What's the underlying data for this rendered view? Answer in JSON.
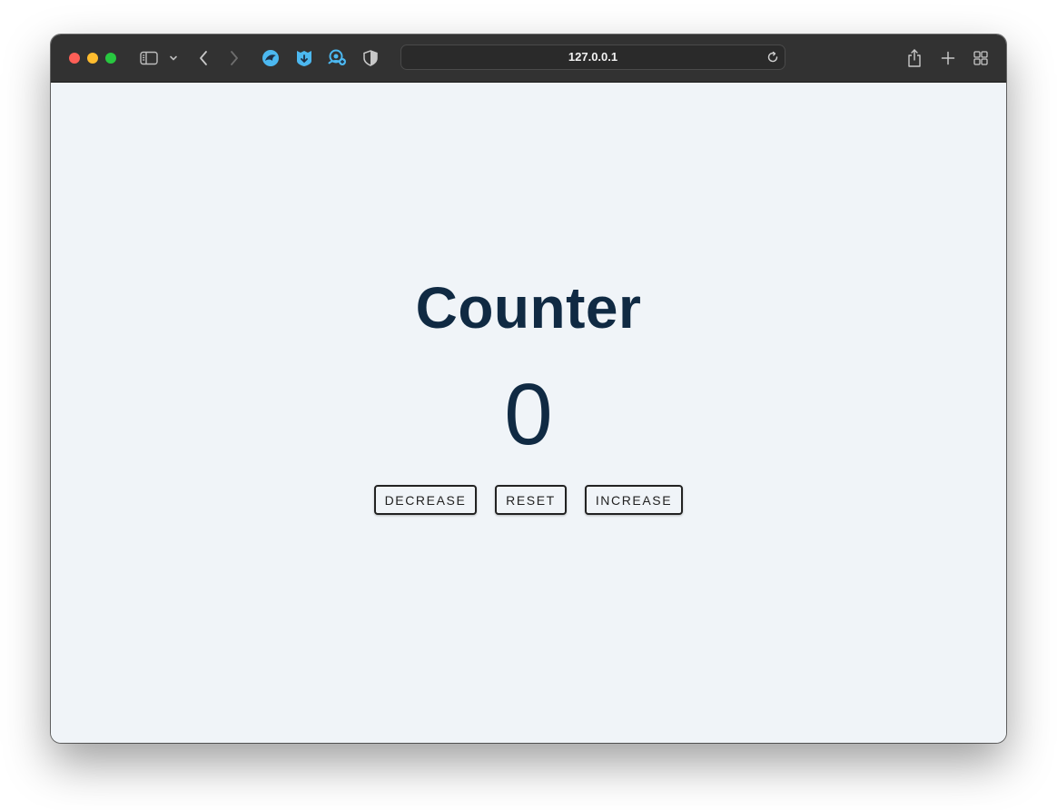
{
  "browser": {
    "url": "127.0.0.1",
    "icons": {
      "sidebar": "sidebar-icon",
      "chevron": "chevron-down-icon",
      "back": "chevron-left-icon",
      "forward": "chevron-right-icon",
      "extensions": [
        "bird-extension-icon",
        "shield-fox-extension-icon",
        "cloud-extension-icon",
        "privacy-shield-icon"
      ],
      "reload": "reload-icon",
      "share": "share-icon",
      "new_tab": "plus-icon",
      "tab_overview": "grid-icon"
    },
    "colors": {
      "toolbar": "#323232",
      "close": "#fe5f57",
      "minimize": "#febc2e",
      "maximize": "#28c840"
    }
  },
  "page": {
    "title": "Counter",
    "count": "0",
    "buttons": {
      "decrease": "DECREASE",
      "reset": "RESET",
      "increase": "INCREASE"
    },
    "colors": {
      "background": "#f0f4f8",
      "text": "#102a43"
    }
  }
}
